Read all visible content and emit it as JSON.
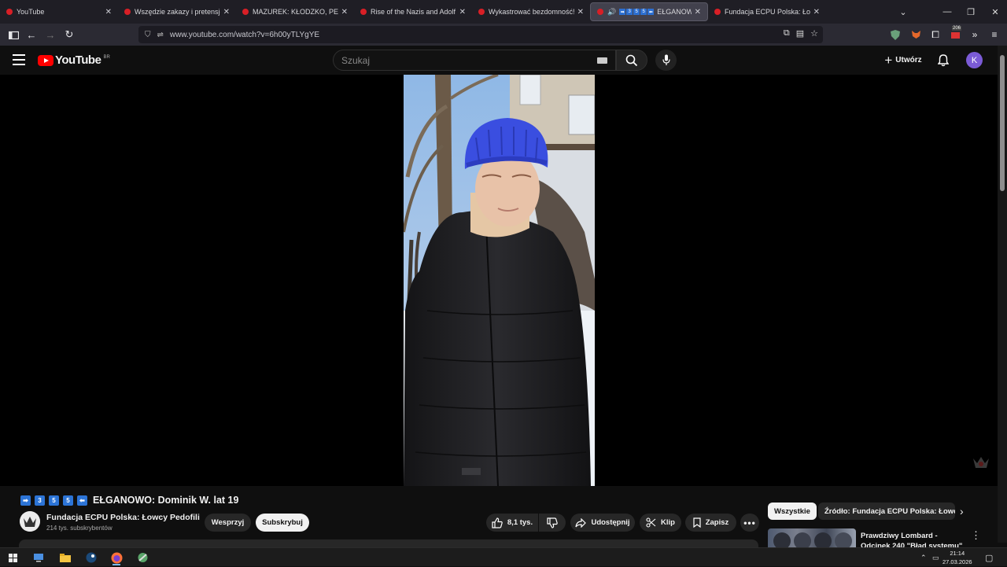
{
  "browser": {
    "tabs": [
      {
        "title": "YouTube",
        "active": false
      },
      {
        "title": "Wszędzie zakazy i pretensje! Lu",
        "active": false
      },
      {
        "title": "MAZUREK: KŁODZKO, PEDOFILI",
        "active": false
      },
      {
        "title": "Rise of the Nazis and Adolf Hitl",
        "active": false
      },
      {
        "title": "Wykastrować bezdomność! Ust",
        "active": false
      },
      {
        "title": "EŁGANOW",
        "active": true,
        "audio": true,
        "badges": [
          "➡",
          "3",
          "5",
          "5",
          "⬅"
        ]
      },
      {
        "title": "Fundacja ECPU Polska: Łowcy P",
        "active": false
      }
    ],
    "url": "www.youtube.com/watch?v=6h00yTLYgYE",
    "ext_count": "206",
    "colors": {
      "tabbar": "#1f1e25",
      "toolbar": "#2b2a33",
      "urlbar": "#1c1b22"
    }
  },
  "youtube": {
    "logo_text": "YouTube",
    "country_code": "BR",
    "search_placeholder": "Szukaj",
    "create_label": "Utwórz",
    "avatar_letter": "K",
    "avatar_color": "#7b5bd6"
  },
  "video": {
    "title_badges": [
      "➡",
      "3",
      "5",
      "5",
      "⬅"
    ],
    "title": "EŁGANOWO: Dominik W. lat 19",
    "channel_name": "Fundacja ECPU Polska: Łowcy Pedofili",
    "subscribers": "214 tys. subskrybentów",
    "support_label": "Wesprzyj",
    "subscribe_label": "Subskrybuj",
    "likes": "8,1 tys.",
    "share_label": "Udostępnij",
    "clip_label": "Klip",
    "save_label": "Zapisz"
  },
  "sidebar": {
    "chips": [
      "Wszystkie",
      "Źródło: Fundacja ECPU Polska: Łowcy"
    ],
    "recommendation_title": "Prawdziwy Lombard - Odcinek 240 \"Błąd systemu\""
  },
  "taskbar": {
    "time": "21:14",
    "date": "27.03.2026"
  }
}
